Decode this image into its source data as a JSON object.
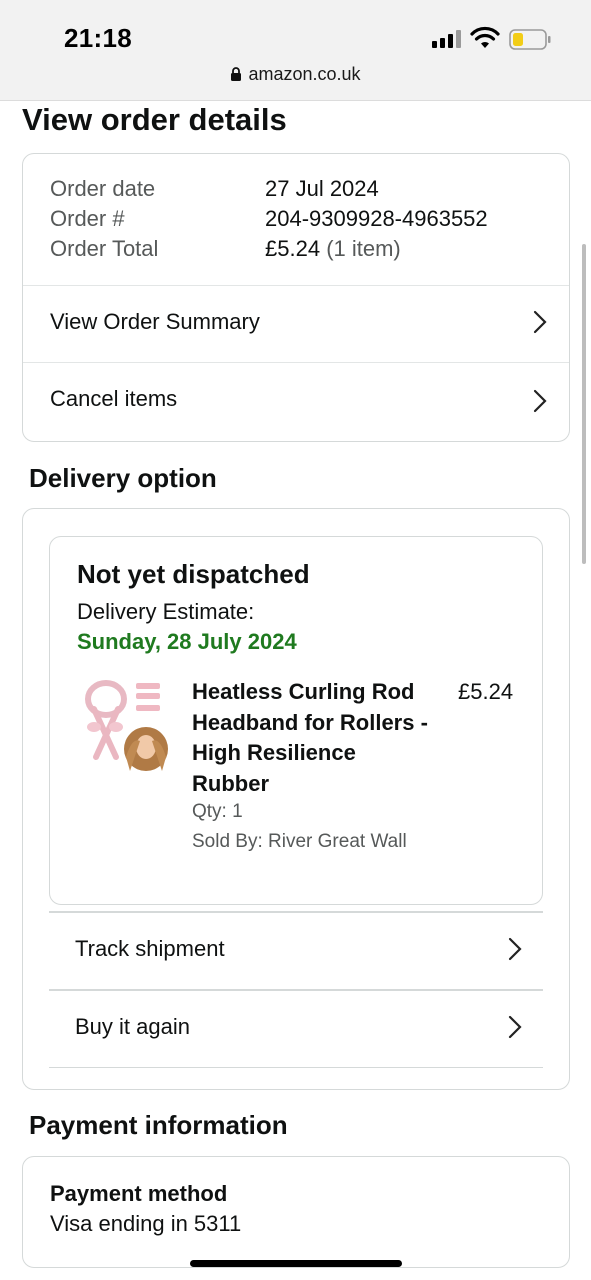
{
  "status_bar": {
    "time": "21:18",
    "url": "amazon.co.uk"
  },
  "page": {
    "title": "View order details"
  },
  "order": {
    "labels": {
      "date": "Order date",
      "number": "Order #",
      "total": "Order Total"
    },
    "values": {
      "date": "27 Jul 2024",
      "number": "204-9309928-4963552",
      "total_amount": "£5.24",
      "total_items": "(1 item)"
    },
    "links": {
      "summary": "View Order Summary",
      "cancel": "Cancel items"
    }
  },
  "delivery": {
    "section_title": "Delivery option",
    "status": "Not yet dispatched",
    "estimate_label": "Delivery Estimate:",
    "estimate_date": "Sunday, 28 July 2024",
    "estimate_color": "#1f7a1f",
    "item": {
      "title": "Heatless Curling Rod Headband for Rollers - High Resilience Rubber",
      "price": "£5.24",
      "qty": "Qty: 1",
      "seller": "Sold By: River Great Wall"
    },
    "links": {
      "track": "Track shipment",
      "buy_again": "Buy it again"
    }
  },
  "payment": {
    "section_title": "Payment information",
    "method_label": "Payment method",
    "method_value": "Visa  ending in 5311"
  },
  "icons": {
    "lock": "lock-icon",
    "chevron": "chevron-right-icon",
    "signal": "cellular-signal-icon",
    "wifi": "wifi-icon",
    "battery": "battery-icon"
  }
}
